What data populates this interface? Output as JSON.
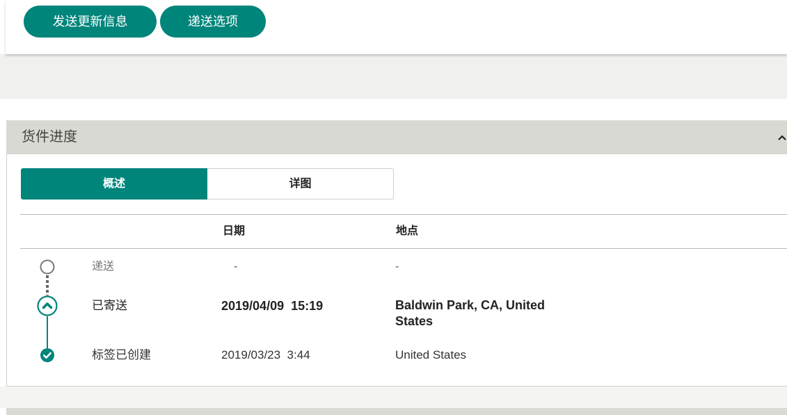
{
  "actions": {
    "send_update_label": "发送更新信息",
    "delivery_options_label": "递送选项"
  },
  "progress": {
    "title": "货件进度",
    "collapse_icon": "chevron-up-icon",
    "tabs": [
      {
        "label": "概述",
        "active": true
      },
      {
        "label": "详图",
        "active": false
      }
    ],
    "columns": {
      "date": "日期",
      "location": "地点"
    },
    "rows": [
      {
        "icon": "circle-outline-icon",
        "status": "递送",
        "date": "-",
        "location": "-"
      },
      {
        "icon": "chevron-up-circle-icon",
        "status": "已寄送",
        "date": "2019/04/09  15:19",
        "location": "Baldwin Park, CA, United States"
      },
      {
        "icon": "check-circle-icon",
        "status": "标签已创建",
        "date": "2019/03/23  3:44",
        "location": "United States"
      }
    ]
  },
  "colors": {
    "accent": "#00857b",
    "panel_header": "#d9d9d4",
    "page_band": "#f0f0ee"
  }
}
